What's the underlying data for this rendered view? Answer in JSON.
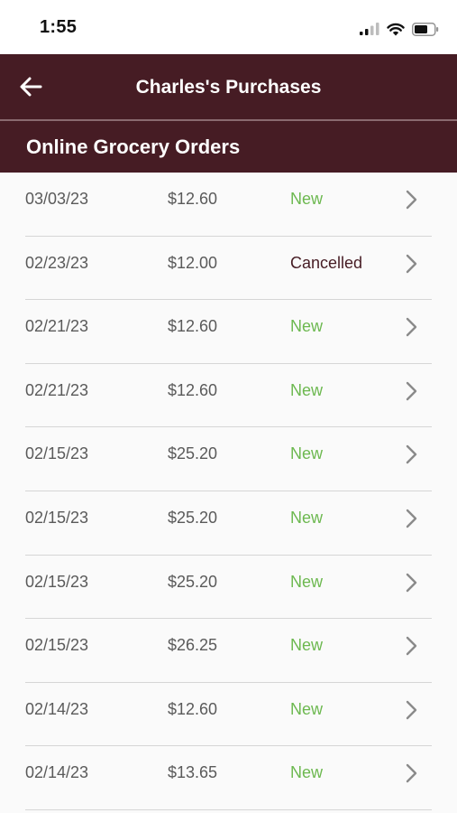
{
  "status_bar": {
    "time": "1:55",
    "icons": [
      "signal-icon",
      "wifi-icon",
      "battery-icon"
    ]
  },
  "nav": {
    "title": "Charles's Purchases",
    "back_icon": "back-arrow-icon"
  },
  "section": {
    "title": "Online Grocery Orders"
  },
  "colors": {
    "brand": "#461c24",
    "status_new": "#6cb84f",
    "status_cancelled": "#461c24"
  },
  "orders": [
    {
      "date": "03/03/23",
      "amount": "$12.60",
      "status": "New"
    },
    {
      "date": "02/23/23",
      "amount": "$12.00",
      "status": "Cancelled"
    },
    {
      "date": "02/21/23",
      "amount": "$12.60",
      "status": "New"
    },
    {
      "date": "02/21/23",
      "amount": "$12.60",
      "status": "New"
    },
    {
      "date": "02/15/23",
      "amount": "$25.20",
      "status": "New"
    },
    {
      "date": "02/15/23",
      "amount": "$25.20",
      "status": "New"
    },
    {
      "date": "02/15/23",
      "amount": "$25.20",
      "status": "New"
    },
    {
      "date": "02/15/23",
      "amount": "$26.25",
      "status": "New"
    },
    {
      "date": "02/14/23",
      "amount": "$12.60",
      "status": "New"
    },
    {
      "date": "02/14/23",
      "amount": "$13.65",
      "status": "New"
    }
  ]
}
